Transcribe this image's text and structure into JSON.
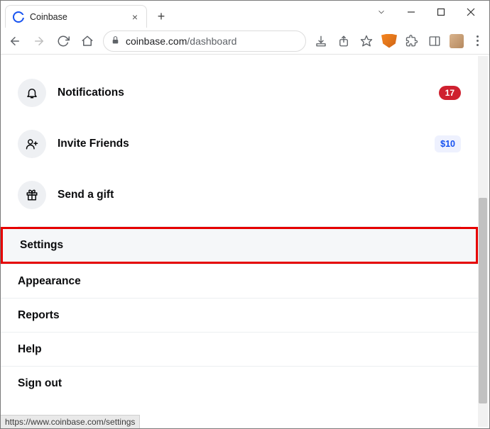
{
  "window": {
    "tab_title": "Coinbase"
  },
  "toolbar": {
    "url_host": "coinbase.com",
    "url_path": "/dashboard"
  },
  "menu": {
    "notifications": {
      "label": "Notifications",
      "count": "17"
    },
    "invite": {
      "label": "Invite Friends",
      "reward": "$10"
    },
    "gift": {
      "label": "Send a gift"
    }
  },
  "settings_rows": {
    "settings": "Settings",
    "appearance": "Appearance",
    "reports": "Reports",
    "help": "Help",
    "signout": "Sign out"
  },
  "status_url": "https://www.coinbase.com/settings"
}
